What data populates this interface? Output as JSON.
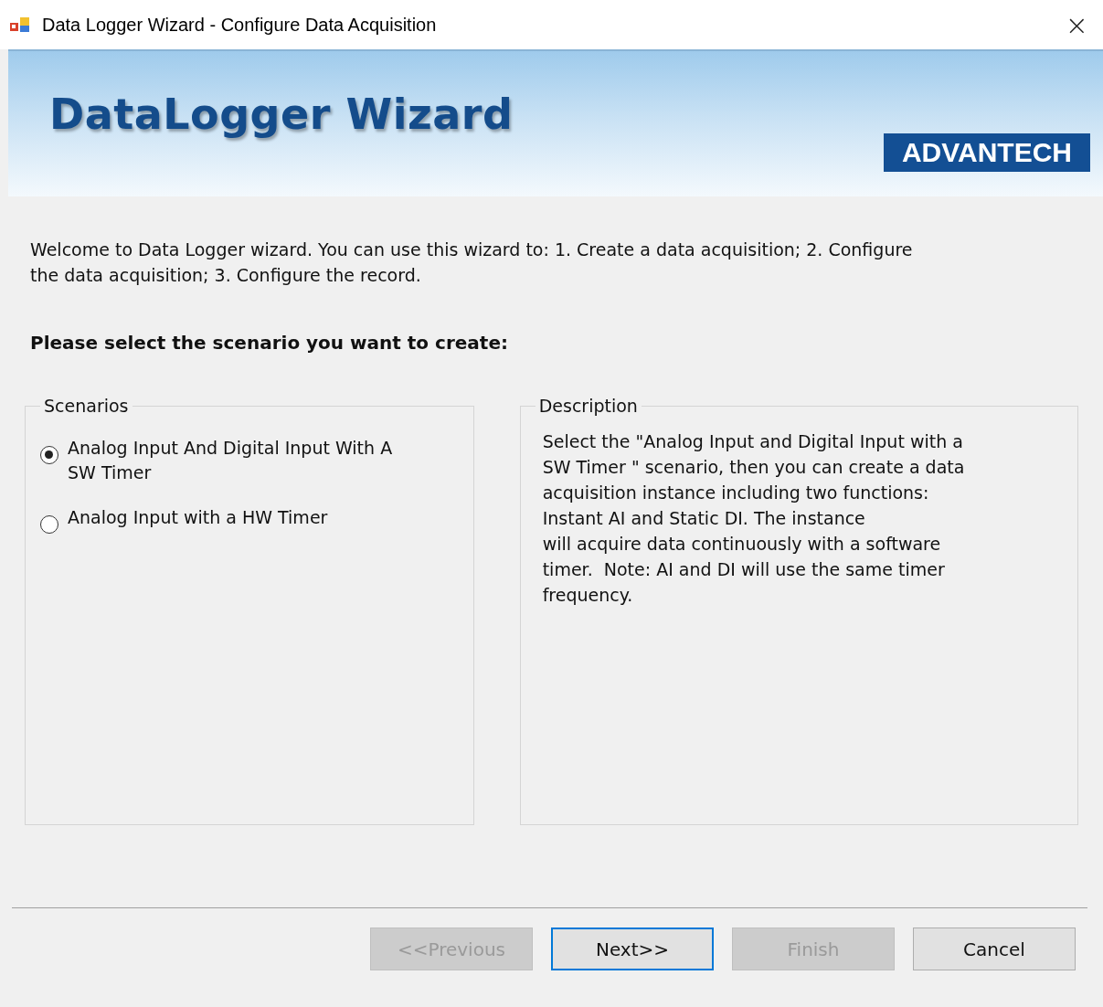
{
  "window": {
    "title": "Data Logger Wizard - Configure Data Acquisition",
    "close": "×"
  },
  "banner": {
    "title": "DataLogger Wizard",
    "logo": "ADVANTECH"
  },
  "welcome": "Welcome to Data Logger wizard. You can use this wizard to: 1. Create a data acquisition; 2. Configure\nthe data acquisition; 3. Configure the record.",
  "prompt": "Please select the scenario you want to create:",
  "scenarios": {
    "title": "Scenarios",
    "options": [
      {
        "label": "Analog Input And Digital Input With A\nSW Timer",
        "selected": true
      },
      {
        "label": "Analog Input with a HW Timer",
        "selected": false
      }
    ]
  },
  "description": {
    "title": "Description",
    "text": "Select the \"Analog Input and Digital Input with a\nSW Timer \" scenario, then you can create a data\nacquisition instance including two functions:\nInstant AI and Static DI. The instance\nwill acquire data continuously with a software\ntimer.  Note: AI and DI will use the same timer\nfrequency."
  },
  "buttons": [
    {
      "label": "<<Previous",
      "disabled": true,
      "default": false
    },
    {
      "label": "Next>>",
      "disabled": false,
      "default": true
    },
    {
      "label": "Finish",
      "disabled": true,
      "default": false
    },
    {
      "label": "Cancel",
      "disabled": false,
      "default": false
    }
  ]
}
